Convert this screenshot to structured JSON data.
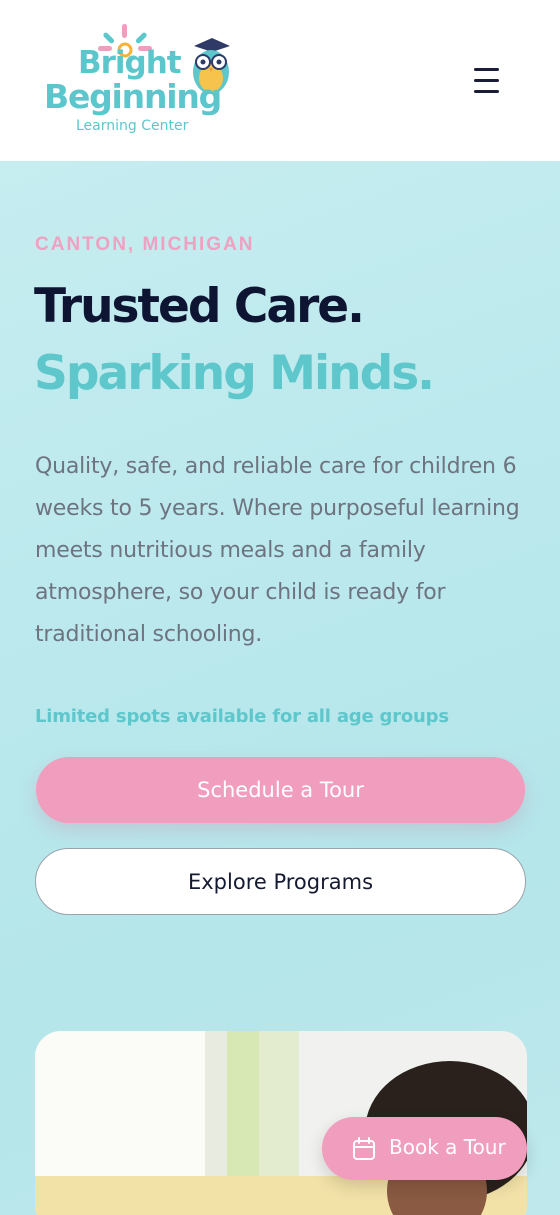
{
  "header": {
    "logo": {
      "line1": "Bright",
      "line2": "Beginning",
      "line3": "Learning Center"
    },
    "menu_icon": "hamburger-menu-icon"
  },
  "hero": {
    "location": "CANTON, MICHIGAN",
    "headline_line1": "Trusted Care.",
    "headline_line2": "Sparking Minds.",
    "description": "Quality, safe, and reliable care for children 6 weeks to 5 years. Where purposeful learning meets nutritious meals and a family atmosphere, so your child is ready for traditional schooling.",
    "availability": "Limited spots available for all age groups",
    "primary_button": "Schedule a Tour",
    "secondary_button": "Explore Programs"
  },
  "floating_button": {
    "label": "Book a Tour",
    "icon": "calendar-icon"
  },
  "colors": {
    "brand_teal": "#5ec7cc",
    "brand_pink": "#f19dbd",
    "navy": "#0e1533",
    "hero_bg": "#bce9ed"
  }
}
